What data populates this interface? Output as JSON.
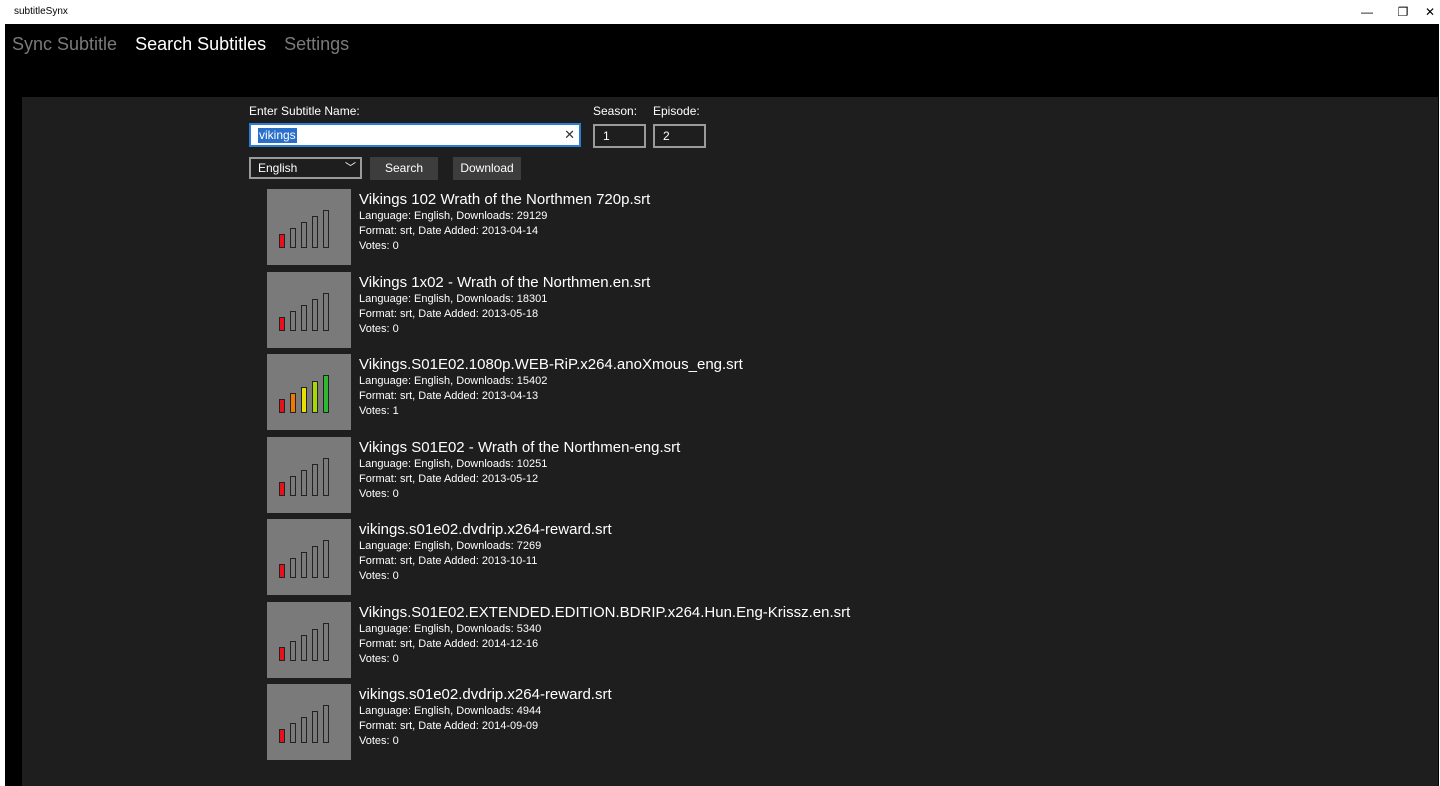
{
  "window": {
    "title": "subtitleSynx",
    "minimize_glyph": "—",
    "maximize_glyph": "❐",
    "close_glyph": "✕"
  },
  "nav": {
    "tabs": [
      "Sync Subtitle",
      "Search Subtitles",
      "Settings"
    ],
    "active": "Search Subtitles"
  },
  "form": {
    "name_label": "Enter Subtitle Name:",
    "name_value": "vikings",
    "season_label": "Season:",
    "season_value": "1",
    "episode_label": "Episode:",
    "episode_value": "2",
    "language": "English",
    "search_label": "Search",
    "download_label": "Download"
  },
  "colors": {
    "signal_red": "#e8101c",
    "signal_orange": "#f07a00",
    "signal_yellow": "#e8e000",
    "signal_lime": "#a8d800",
    "signal_green": "#2db830"
  },
  "results": [
    {
      "name": "Vikings 102 Wrath of the Northmen 720p.srt",
      "lang_line": "Language: English, Downloads: 29129",
      "format_line": "Format: srt, Date Added: 2013-04-14",
      "votes_line": "Votes: 0",
      "rating_bars": 1
    },
    {
      "name": "Vikings 1x02 - Wrath of the Northmen.en.srt",
      "lang_line": "Language: English, Downloads: 18301",
      "format_line": "Format: srt, Date Added: 2013-05-18",
      "votes_line": "Votes: 0",
      "rating_bars": 1
    },
    {
      "name": "Vikings.S01E02.1080p.WEB-RiP.x264.anoXmous_eng.srt",
      "lang_line": "Language: English, Downloads: 15402",
      "format_line": "Format: srt, Date Added: 2013-04-13",
      "votes_line": "Votes: 1",
      "rating_bars": 5
    },
    {
      "name": "Vikings S01E02 - Wrath of the Northmen-eng.srt",
      "lang_line": "Language: English, Downloads: 10251",
      "format_line": "Format: srt, Date Added: 2013-05-12",
      "votes_line": "Votes: 0",
      "rating_bars": 1
    },
    {
      "name": "vikings.s01e02.dvdrip.x264-reward.srt",
      "lang_line": "Language: English, Downloads: 7269",
      "format_line": "Format: srt, Date Added: 2013-10-11",
      "votes_line": "Votes: 0",
      "rating_bars": 1
    },
    {
      "name": "Vikings.S01E02.EXTENDED.EDITION.BDRIP.x264.Hun.Eng-Krissz.en.srt",
      "lang_line": "Language: English, Downloads: 5340",
      "format_line": "Format: srt, Date Added: 2014-12-16",
      "votes_line": "Votes: 0",
      "rating_bars": 1
    },
    {
      "name": "vikings.s01e02.dvdrip.x264-reward.srt",
      "lang_line": "Language: English, Downloads: 4944",
      "format_line": "Format: srt, Date Added: 2014-09-09",
      "votes_line": "Votes: 0",
      "rating_bars": 1
    }
  ]
}
